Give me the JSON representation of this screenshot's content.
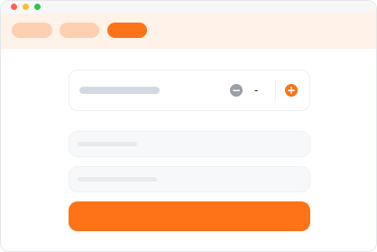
{
  "colors": {
    "accent": "#fc7318",
    "accent_light": "#fecfb1",
    "navbar_bg": "#fff2e8",
    "placeholder": "#d3d9e3",
    "field_bg": "#f7f8fa",
    "field_placeholder": "#e8eaee",
    "minus_button": "#9aa0a8",
    "window_red": "#ff5f57",
    "window_yellow": "#febc2e",
    "window_green": "#28c840"
  },
  "icons": {
    "minus": "minus-icon",
    "plus": "plus-icon"
  },
  "stepper": {
    "minus_glyph": "−",
    "value": "-",
    "plus_glyph": "+"
  }
}
